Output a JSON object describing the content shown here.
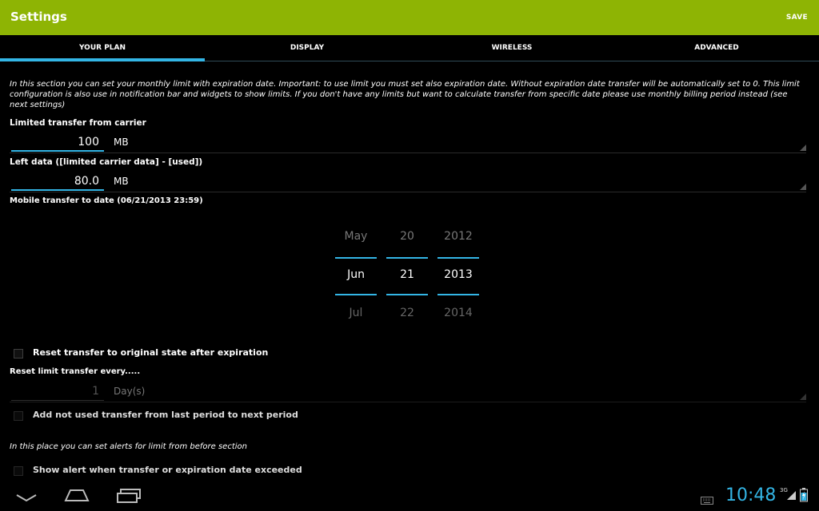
{
  "actionbar": {
    "title": "Settings",
    "save_label": "SAVE"
  },
  "tabs": [
    {
      "label": "YOUR PLAN",
      "active": true
    },
    {
      "label": "DISPLAY",
      "active": false
    },
    {
      "label": "WIRELESS",
      "active": false
    },
    {
      "label": "ADVANCED",
      "active": false
    }
  ],
  "plan": {
    "intro": "In this section you can set your monthly limit with expiration date. Important: to use limit you must set also expiration date. Without expiration date transfer will be automatically set to 0. This limit configuration is also use in notification bar and widgets to show limits. If you don't have any limits but want to calculate transfer from specific date please use monthly billing period instead (see next settings)",
    "limited_label": "Limited transfer from carrier",
    "limited_value": "100",
    "limited_unit": "MB",
    "left_label": "Left data ([limited carrier data] - [used])",
    "left_value": "80.0",
    "left_unit": "MB",
    "mobile_to_date_label": "Mobile transfer to date (06/21/2013 23:59)",
    "date_picker": {
      "month": {
        "prev": "May",
        "current": "Jun",
        "next": "Jul"
      },
      "day": {
        "prev": "20",
        "current": "21",
        "next": "22"
      },
      "year": {
        "prev": "2012",
        "current": "2013",
        "next": "2014"
      }
    },
    "reset_checkbox_label": "Reset transfer to original state after expiration",
    "reset_every_label": "Reset limit transfer every.....",
    "reset_every_value": "1",
    "reset_every_unit": "Day(s)",
    "add_unused_label": "Add not used transfer from last period to next period",
    "alerts_note": "In this place you can set alerts for limit from before section",
    "show_alert_label": "Show alert when transfer or expiration date exceeded"
  },
  "status": {
    "time": "10:48",
    "network": "3G"
  },
  "colors": {
    "actionbar": "#8eb404",
    "accent": "#33b5e5"
  }
}
